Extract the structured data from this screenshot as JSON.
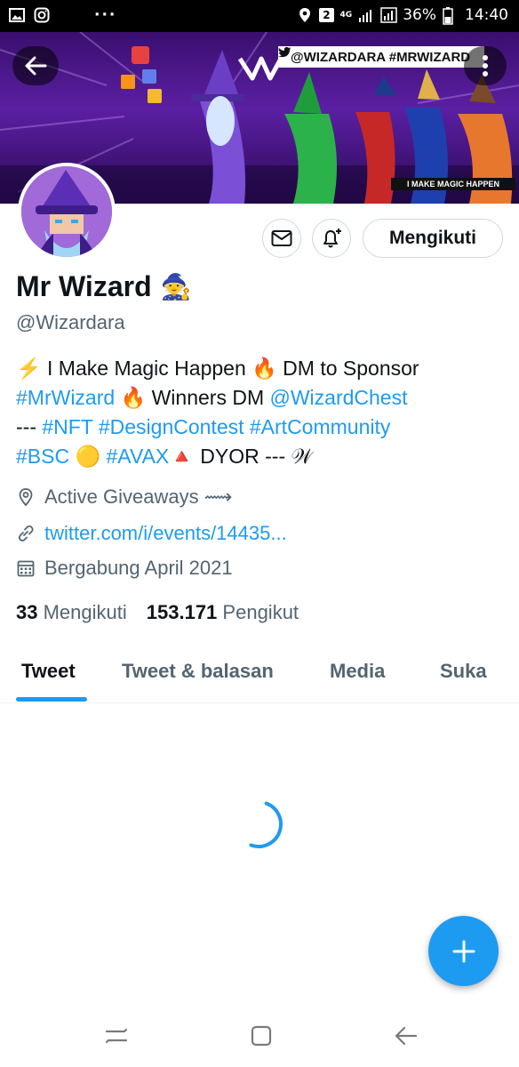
{
  "status_bar": {
    "battery_percent": "36%",
    "time": "14:40",
    "sim_badge": "2",
    "network_type": "4G"
  },
  "banner": {
    "tag_text": "@WIZARDARA  #MRWIZARD",
    "caption": "I MAKE MAGIC HAPPEN",
    "logo_letter": "W"
  },
  "profile": {
    "display_name": "Mr Wizard",
    "name_emoji": "🧙",
    "handle": "@Wizardara",
    "follow_button_label": "Mengikuti",
    "bio": {
      "line1_emoji1": "⚡",
      "line1_text": " I Make Magic Happen  ",
      "line1_emoji2": "🔥",
      "line1_text2": " DM to Sponsor",
      "line2_hashtag": "#MrWizard",
      "line2_emoji": " 🔥",
      "line2_text": " Winners DM ",
      "line2_mention": "@WizardChest",
      "line3_text": "--- ",
      "line3_tags": "#NFT #DesignContest #ArtCommunity",
      "line4_tag1": "#BSC",
      "line4_emoji1": " 🟡 ",
      "line4_tag2": "#AVAX",
      "line4_emoji2": "🔺",
      "line4_text": " DYOR --- ",
      "line4_end": "𝒲"
    },
    "location": "Active Giveaways ⟿",
    "website": "twitter.com/i/events/14435...",
    "joined": "Bergabung April 2021",
    "following_count": "33",
    "following_label": "Mengikuti",
    "followers_count": "153.171",
    "followers_label": "Pengikut"
  },
  "tabs": [
    {
      "label": "Tweet"
    },
    {
      "label": "Tweet & balasan"
    },
    {
      "label": "Media"
    },
    {
      "label": "Suka"
    }
  ],
  "colors": {
    "accent": "#1d9bf0",
    "text_primary": "#0f1419",
    "text_secondary": "#536471"
  }
}
